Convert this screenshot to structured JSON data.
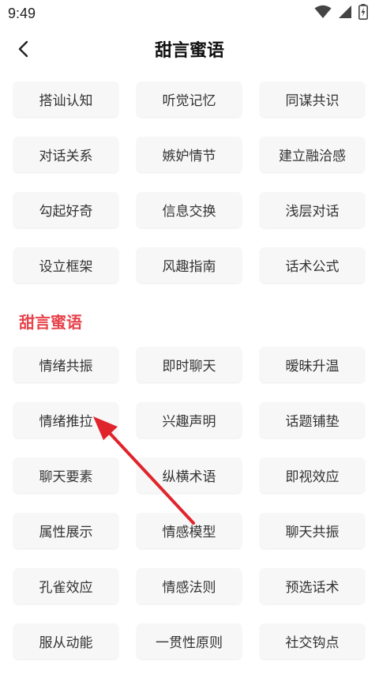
{
  "status_bar": {
    "time": "9:49"
  },
  "header": {
    "title": "甜言蜜语"
  },
  "section1": {
    "items": [
      "搭讪认知",
      "听觉记忆",
      "同谋共识",
      "对话关系",
      "嫉妒情节",
      "建立融洽感",
      "勾起好奇",
      "信息交换",
      "浅层对话",
      "设立框架",
      "风趣指南",
      "话术公式"
    ]
  },
  "section2": {
    "title": "甜言蜜语",
    "items": [
      "情绪共振",
      "即时聊天",
      "暧昧升温",
      "情绪推拉",
      "兴趣声明",
      "话题铺垫",
      "聊天要素",
      "纵横术语",
      "即视效应",
      "属性展示",
      "情感模型",
      "聊天共振",
      "孔雀效应",
      "情感法则",
      "预选话术",
      "服从动能",
      "一贯性原则",
      "社交钩点"
    ]
  },
  "colors": {
    "accent": "#e8414a",
    "tag_bg": "#f7f7f7",
    "annotation_arrow": "#e0242c"
  }
}
